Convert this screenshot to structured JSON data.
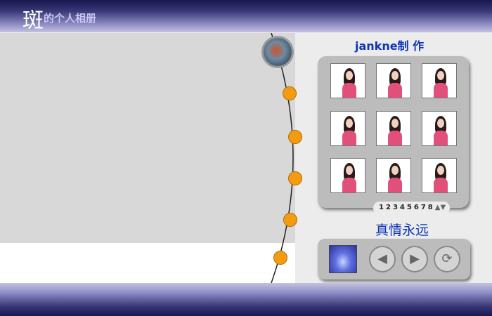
{
  "header": {
    "logo_char": "斑",
    "title": "的个人相册"
  },
  "author_label": "jankne制 作",
  "motto": "真情永远",
  "pagination": {
    "pages": [
      "1",
      "2",
      "3",
      "4",
      "5",
      "6",
      "7",
      "8"
    ],
    "up_icon": "▲",
    "down_icon": "▼"
  },
  "controls": {
    "prev_icon": "◀",
    "next_icon": "▶",
    "loop_icon": "⟳"
  },
  "colors": {
    "accent_blue": "#1034b8",
    "dot_orange": "#f39c12",
    "header_dark": "#1a1850"
  }
}
